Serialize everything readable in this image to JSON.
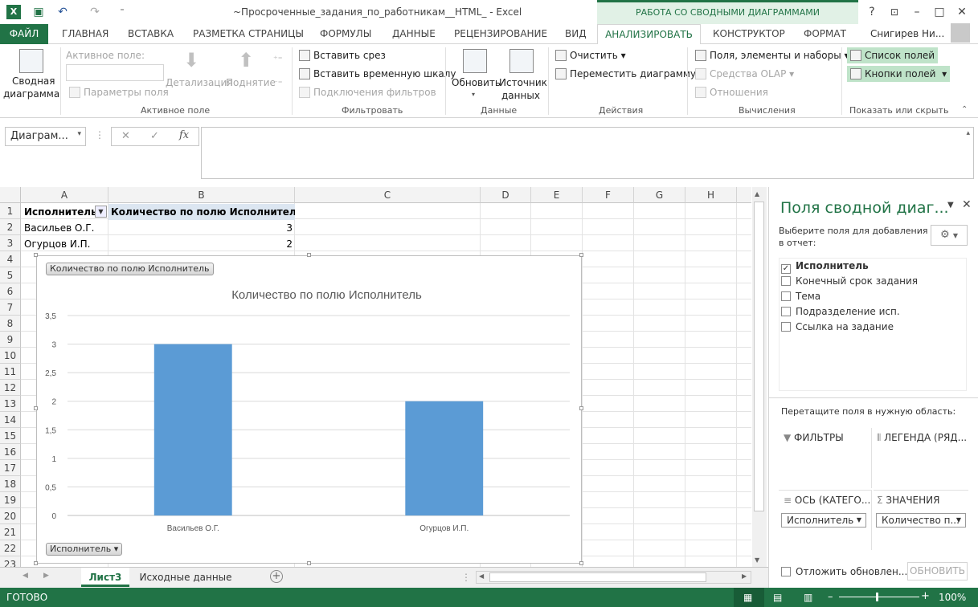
{
  "window": {
    "title": "~Просроченные_задания_по_работникам__HTML_ - Excel",
    "context_header": "РАБОТА СО СВОДНЫМИ ДИАГРАММАМИ",
    "user": "Снигирев Ни..."
  },
  "tabs": [
    "ФАЙЛ",
    "ГЛАВНАЯ",
    "ВСТАВКА",
    "РАЗМЕТКА СТРАНИЦЫ",
    "ФОРМУЛЫ",
    "ДАННЫЕ",
    "РЕЦЕНЗИРОВАНИЕ",
    "ВИД",
    "АНАЛИЗИРОВАТЬ",
    "КОНСТРУКТОР",
    "ФОРМАТ"
  ],
  "ribbon": {
    "pivot_chart_line1": "Сводная",
    "pivot_chart_line2": "диаграмма",
    "active_field_label": "Активное поле:",
    "field_params": "Параметры поля",
    "drill_down": "Детализация",
    "drill_up": "Поднятие",
    "group_active_field": "Активное поле",
    "insert_slicer": "Вставить срез",
    "insert_timeline": "Вставить временную шкалу",
    "filter_connections": "Подключения фильтров",
    "group_filter": "Фильтровать",
    "refresh": "Обновить",
    "source_line1": "Источник",
    "source_line2": "данных",
    "group_data": "Данные",
    "clear": "Очистить",
    "move_chart": "Переместить диаграмму",
    "group_actions": "Действия",
    "fields_items_sets": "Поля, элементы и наборы",
    "olap_tools": "Средства OLAP",
    "relationships": "Отношения",
    "group_calc": "Вычисления",
    "field_list": "Список полей",
    "field_buttons": "Кнопки полей",
    "group_show": "Показать или скрыть"
  },
  "formula_bar": {
    "name_box": "Диаграм..."
  },
  "grid": {
    "columns": [
      "A",
      "B",
      "C",
      "D",
      "E",
      "F",
      "G",
      "H"
    ],
    "rows": [
      "1",
      "2",
      "3",
      "4",
      "5",
      "6",
      "7",
      "8",
      "9",
      "10",
      "11",
      "12",
      "13",
      "14",
      "15",
      "16",
      "17",
      "18",
      "19",
      "20",
      "21",
      "22",
      "23"
    ],
    "header_a": "Исполнитель",
    "header_b": "Количество по полю Исполнитель",
    "row2_a": "Васильев О.Г.",
    "row2_b": "3",
    "row3_a": "Огурцов И.П.",
    "row3_b": "2"
  },
  "chart_buttons": {
    "value_field": "Количество по полю Исполнитель",
    "axis_field": "Исполнитель"
  },
  "chart_data": {
    "type": "bar",
    "title": "Количество по полю Исполнитель",
    "categories": [
      "Васильев О.Г.",
      "Огурцов И.П."
    ],
    "values": [
      3,
      2
    ],
    "ylim": [
      0,
      3.5
    ],
    "yticks": [
      "0",
      "0,5",
      "1",
      "1,5",
      "2",
      "2,5",
      "3",
      "3,5"
    ],
    "bar_color": "#5B9BD5",
    "grid": true,
    "legend": "none"
  },
  "sheets": {
    "active": "Лист3",
    "other": "Исходные данные"
  },
  "pane": {
    "title": "Поля сводной диаг...",
    "choose_label_1": "Выберите поля для добавления",
    "choose_label_2": "в отчет:",
    "fields": [
      {
        "label": "Исполнитель",
        "checked": true
      },
      {
        "label": "Конечный срок задания",
        "checked": false
      },
      {
        "label": "Тема",
        "checked": false
      },
      {
        "label": "Подразделение исп.",
        "checked": false
      },
      {
        "label": "Ссылка на задание",
        "checked": false
      }
    ],
    "drag_label": "Перетащите поля в нужную область:",
    "filters": "ФИЛЬТРЫ",
    "legend": "ЛЕГЕНДА (РЯД...",
    "axis": "ОСЬ (КАТЕГО...",
    "values": "ЗНАЧЕНИЯ",
    "axis_item": "Исполнитель",
    "values_item": "Количество п...",
    "defer": "Отложить обновлен...",
    "update": "ОБНОВИТЬ"
  },
  "status": {
    "ready": "ГОТОВО",
    "zoom": "100%"
  },
  "colors": {
    "accent": "#217346"
  }
}
